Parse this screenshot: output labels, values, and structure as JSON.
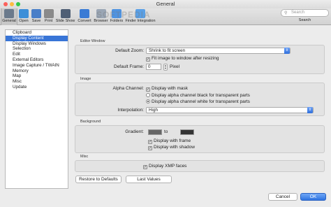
{
  "window": {
    "title": "General"
  },
  "watermark": "SOFTPEDIA",
  "toolbar": {
    "items": [
      {
        "label": "General",
        "icon": "general-icon",
        "color": "#6b7a8c"
      },
      {
        "label": "Open",
        "icon": "open-icon",
        "color": "#3d8fd8"
      },
      {
        "label": "Save",
        "icon": "save-icon",
        "color": "#4a7fc8"
      },
      {
        "label": "Print",
        "icon": "print-icon",
        "color": "#8a8a8a"
      },
      {
        "label": "Slide Show",
        "icon": "slideshow-icon",
        "color": "#4f5f75"
      },
      {
        "label": "Convert",
        "icon": "convert-icon",
        "color": "#3a7bd5"
      },
      {
        "label": "Browser",
        "icon": "browser-icon",
        "color": "#9aa6b5"
      },
      {
        "label": "Folders",
        "icon": "folders-icon",
        "color": "#4f93e0"
      },
      {
        "label": "Finder Integration",
        "icon": "finder-icon",
        "color": "#5aa0e6"
      }
    ],
    "search_placeholder": "Search",
    "search_label": "Search"
  },
  "sidebar": {
    "items": [
      {
        "label": "Clipboard",
        "selected": false
      },
      {
        "label": "Display Content",
        "selected": true
      },
      {
        "label": "Display Windows",
        "selected": false
      },
      {
        "label": "Selection",
        "selected": false
      },
      {
        "label": "Edit",
        "selected": false
      },
      {
        "label": "External Editors",
        "selected": false
      },
      {
        "label": "Image Capture / TWAIN",
        "selected": false
      },
      {
        "label": "Memory",
        "selected": false
      },
      {
        "label": "Map",
        "selected": false
      },
      {
        "label": "Misc",
        "selected": false
      },
      {
        "label": "Update",
        "selected": false
      }
    ]
  },
  "editor_window": {
    "group_label": "Editor Window",
    "default_zoom_label": "Default Zoom:",
    "default_zoom_value": "Shrink to fit screen",
    "fit_image_label": "Fit image to window after resizing",
    "fit_image_checked": true,
    "default_frame_label": "Default Frame:",
    "default_frame_value": "0",
    "default_frame_unit": "Pixel"
  },
  "image": {
    "group_label": "Image",
    "alpha_channel_label": "Alpha Channel:",
    "display_with_mask": "Display with mask",
    "display_with_mask_checked": true,
    "alpha_black": "Display alpha channel black for transparent parts",
    "alpha_white": "Display alpha channel white for transparent parts",
    "alpha_selected": "white",
    "interpolation_label": "Interpolation:",
    "interpolation_value": "High"
  },
  "background": {
    "group_label": "Background",
    "gradient_label": "Gradient:",
    "gradient_to": "to",
    "gradient_from_color": "#666666",
    "gradient_to_color": "#333333",
    "display_with_frame": "Display with frame",
    "display_with_frame_checked": true,
    "display_with_shadow": "Display with shadow",
    "display_with_shadow_checked": true
  },
  "misc": {
    "group_label": "Misc",
    "display_xmp": "Display XMP faces",
    "display_xmp_checked": true
  },
  "buttons": {
    "restore_defaults": "Restore to Defaults",
    "last_values": "Last Values",
    "cancel": "Cancel",
    "ok": "OK"
  },
  "colors": {
    "selection": "#3875d7",
    "primary_button": "#2f74e1"
  }
}
